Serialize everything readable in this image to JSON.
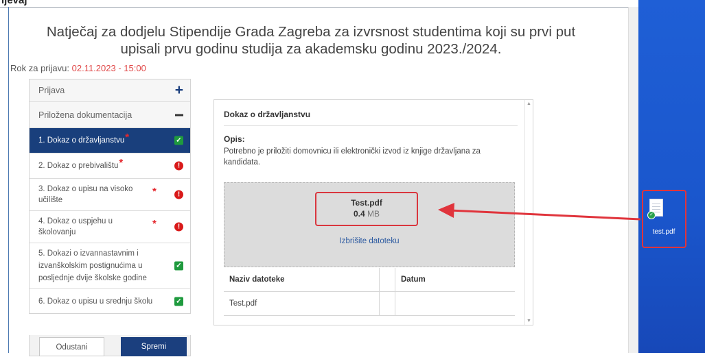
{
  "header": {
    "caption": "ijevaj",
    "title_line1": "Natječaj za dodjelu Stipendije Grada Zagreba za izvrsnost studentima koji su prvi put",
    "title_line2": "upisali prvu godinu studija za akademsku godinu 2023./2024.",
    "deadline_label": "Rok za prijavu:",
    "deadline_value": "02.11.2023 - 15:00"
  },
  "menu": {
    "items": [
      {
        "label": "Prijava",
        "type": "section",
        "icon": "plus-icon"
      },
      {
        "label": "Priložena dokumentacija",
        "type": "section",
        "icon": "minus-icon"
      },
      {
        "label": "1. Dokaz o državljanstvu",
        "required": true,
        "status": "ok",
        "active": true
      },
      {
        "label": "2. Dokaz o prebivalištu",
        "required": true,
        "status": "error"
      },
      {
        "label": "3. Dokaz o upisu na visoko učilište",
        "required": true,
        "status": "error"
      },
      {
        "label": "4. Dokaz o uspjehu u školovanju",
        "required": true,
        "status": "error"
      },
      {
        "label": "5. Dokazi o izvannastavnim i izvanškolskim postignućima u posljednje dvije školske godine",
        "required": false,
        "status": "ok"
      },
      {
        "label": "6. Dokaz o upisu u srednju školu",
        "required": false,
        "status": "ok"
      }
    ],
    "required_mark": "*",
    "cancel_label": "Odustani",
    "save_label": "Spremi"
  },
  "panel": {
    "title": "Dokaz o državljanstvu",
    "desc_label": "Opis:",
    "description": "Potrebno je priložiti domovnicu ili elektronički izvod iz knjige državljana za kandidata.",
    "uploaded_file": {
      "name": "Test.pdf",
      "size_value": "0.4",
      "size_unit": "MB"
    },
    "delete_link": "Izbrišite datoteku",
    "table": {
      "columns": [
        "Naziv datoteke",
        "Datum"
      ],
      "rows": [
        [
          "Test.pdf",
          ""
        ]
      ]
    }
  },
  "desktop": {
    "file_label": "test.pdf",
    "background_color": "#1f5fd6"
  },
  "colors": {
    "accent": "#1b3f7e",
    "error": "#d91a1a",
    "ok": "#1f9a3e",
    "highlight": "#e0343c",
    "deadline": "#e04848"
  }
}
